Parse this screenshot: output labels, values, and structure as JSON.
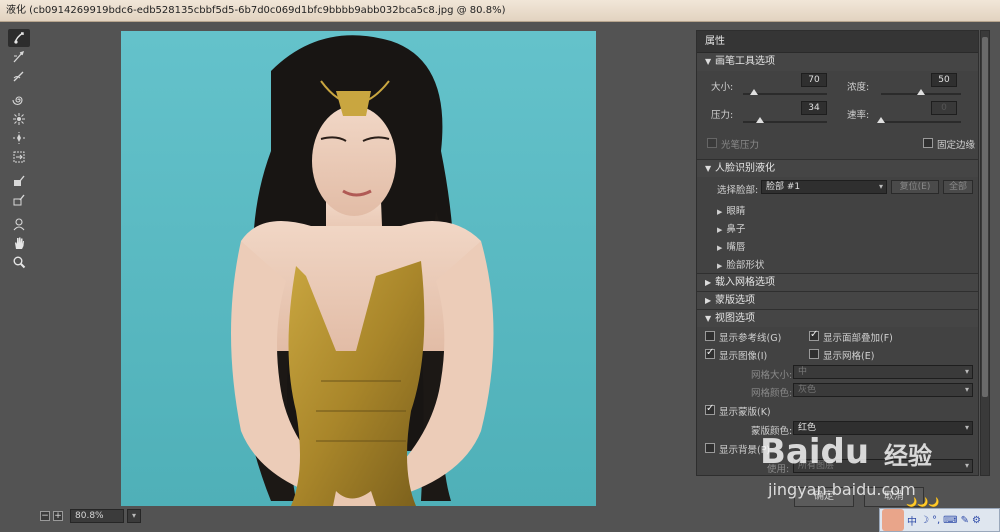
{
  "window": {
    "title": "液化 (cb0914269919bdc6-edb528135cbbf5d5-6b7d0c069d1bfc9bbbb9abb032bca5c8.jpg @ 80.8%)"
  },
  "toolbar": {
    "tools": [
      {
        "icon": "forward-warp-icon"
      },
      {
        "icon": "reconstruct-icon"
      },
      {
        "icon": "smooth-icon"
      },
      {
        "icon": "twirl-icon"
      },
      {
        "icon": "pucker-icon"
      },
      {
        "icon": "bloat-icon"
      },
      {
        "icon": "push-left-icon"
      },
      {
        "icon": "freeze-mask-icon"
      },
      {
        "icon": "thaw-mask-icon"
      },
      {
        "icon": "face-tool-icon"
      },
      {
        "icon": "hand-icon"
      },
      {
        "icon": "zoom-icon"
      }
    ]
  },
  "zoom": {
    "minus": "−",
    "plus": "+",
    "value": "80.8%"
  },
  "properties": {
    "title": "属性",
    "brush": {
      "header": "画笔工具选项",
      "size_label": "大小:",
      "size_value": "70",
      "size_level": 0.13,
      "density_label": "浓度:",
      "density_value": "50",
      "density_level": 0.5,
      "pressure_label": "压力:",
      "pressure_value": "34",
      "pressure_level": 0.2,
      "rate_label": "速率:",
      "rate_value": "0",
      "rate_level": 0.0,
      "stylus_label": "光笔压力",
      "pin_edges_label": "固定边缘"
    },
    "face": {
      "header": "人脸识别液化",
      "select_label": "选择脸部:",
      "select_value": "脸部 #1",
      "reset_label": "复位(E)",
      "all_label": "全部",
      "items": [
        "眼睛",
        "鼻子",
        "嘴唇",
        "脸部形状"
      ]
    },
    "load_mesh": {
      "header": "载入网格选项"
    },
    "mask": {
      "header": "蒙版选项"
    },
    "view": {
      "header": "视图选项",
      "show_guides": "显示参考线(G)",
      "show_face_overlay": "显示面部叠加(F)",
      "show_image": "显示图像(I)",
      "show_mesh": "显示网格(E)",
      "mesh_size_label": "网格大小:",
      "mesh_size_value": "中",
      "mesh_color_label": "网格颜色:",
      "mesh_color_value": "灰色",
      "show_mask": "显示蒙版(K)",
      "mask_color_label": "蒙版颜色:",
      "mask_color_value": "红色",
      "show_backdrop": "显示背景(P)",
      "use_label": "使用:",
      "use_value": "所有图层"
    }
  },
  "buttons": {
    "ok": "确定",
    "cancel": "取消"
  },
  "watermark": {
    "brand": "Baidu",
    "cn": "经验",
    "url": "jingyan.baidu.com"
  },
  "ime": {
    "items": [
      "中",
      "☽",
      "°,",
      "⌨",
      "✎",
      "⚙"
    ],
    "moons": "🌙🌙🌙"
  },
  "colors": {
    "bg": "#535353",
    "panel": "#424242",
    "photo_bg": "#5fbdc6"
  }
}
